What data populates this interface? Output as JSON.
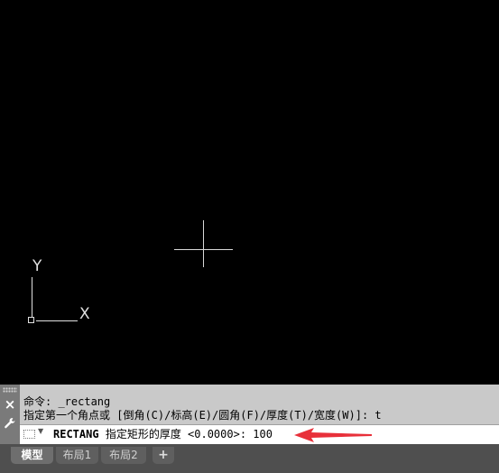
{
  "viewport": {
    "ucs_icon": {
      "y_label": "Y",
      "x_label": "X"
    }
  },
  "command_panel": {
    "close_icon": "×",
    "settings_icon": "🔧",
    "history": [
      "命令: _rectang",
      "指定第一个角点或 [倒角(C)/标高(E)/圆角(F)/厚度(T)/宽度(W)]: t"
    ],
    "prompt": {
      "command": "RECTANG",
      "text": "指定矩形的厚度 <0.0000>: ",
      "input_value": "100"
    },
    "annotation_arrow_color": "#e8303a"
  },
  "layout_tabs": {
    "tabs": [
      "模型",
      "布局1",
      "布局2"
    ],
    "add_label": "+"
  }
}
